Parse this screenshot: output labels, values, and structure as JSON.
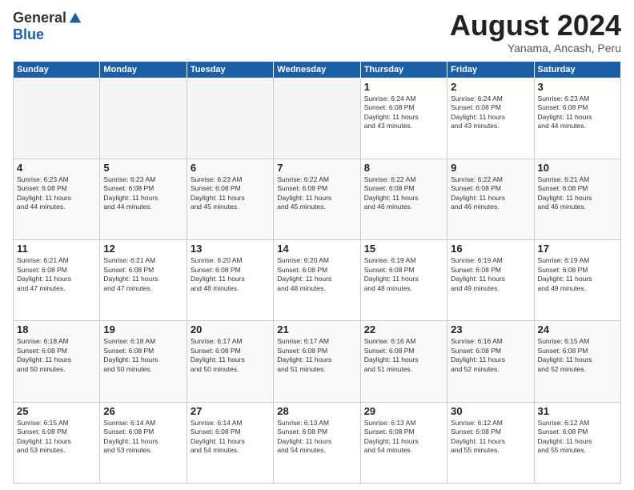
{
  "header": {
    "logo": {
      "general": "General",
      "blue": "Blue"
    },
    "title": "August 2024",
    "subtitle": "Yanama, Ancash, Peru"
  },
  "days_of_week": [
    "Sunday",
    "Monday",
    "Tuesday",
    "Wednesday",
    "Thursday",
    "Friday",
    "Saturday"
  ],
  "weeks": [
    [
      {
        "num": "",
        "info": ""
      },
      {
        "num": "",
        "info": ""
      },
      {
        "num": "",
        "info": ""
      },
      {
        "num": "",
        "info": ""
      },
      {
        "num": "1",
        "info": "Sunrise: 6:24 AM\nSunset: 6:08 PM\nDaylight: 11 hours\nand 43 minutes."
      },
      {
        "num": "2",
        "info": "Sunrise: 6:24 AM\nSunset: 6:08 PM\nDaylight: 11 hours\nand 43 minutes."
      },
      {
        "num": "3",
        "info": "Sunrise: 6:23 AM\nSunset: 6:08 PM\nDaylight: 11 hours\nand 44 minutes."
      }
    ],
    [
      {
        "num": "4",
        "info": "Sunrise: 6:23 AM\nSunset: 6:08 PM\nDaylight: 11 hours\nand 44 minutes."
      },
      {
        "num": "5",
        "info": "Sunrise: 6:23 AM\nSunset: 6:08 PM\nDaylight: 11 hours\nand 44 minutes."
      },
      {
        "num": "6",
        "info": "Sunrise: 6:23 AM\nSunset: 6:08 PM\nDaylight: 11 hours\nand 45 minutes."
      },
      {
        "num": "7",
        "info": "Sunrise: 6:22 AM\nSunset: 6:08 PM\nDaylight: 11 hours\nand 45 minutes."
      },
      {
        "num": "8",
        "info": "Sunrise: 6:22 AM\nSunset: 6:08 PM\nDaylight: 11 hours\nand 46 minutes."
      },
      {
        "num": "9",
        "info": "Sunrise: 6:22 AM\nSunset: 6:08 PM\nDaylight: 11 hours\nand 46 minutes."
      },
      {
        "num": "10",
        "info": "Sunrise: 6:21 AM\nSunset: 6:08 PM\nDaylight: 11 hours\nand 46 minutes."
      }
    ],
    [
      {
        "num": "11",
        "info": "Sunrise: 6:21 AM\nSunset: 6:08 PM\nDaylight: 11 hours\nand 47 minutes."
      },
      {
        "num": "12",
        "info": "Sunrise: 6:21 AM\nSunset: 6:08 PM\nDaylight: 11 hours\nand 47 minutes."
      },
      {
        "num": "13",
        "info": "Sunrise: 6:20 AM\nSunset: 6:08 PM\nDaylight: 11 hours\nand 48 minutes."
      },
      {
        "num": "14",
        "info": "Sunrise: 6:20 AM\nSunset: 6:08 PM\nDaylight: 11 hours\nand 48 minutes."
      },
      {
        "num": "15",
        "info": "Sunrise: 6:19 AM\nSunset: 6:08 PM\nDaylight: 11 hours\nand 48 minutes."
      },
      {
        "num": "16",
        "info": "Sunrise: 6:19 AM\nSunset: 6:08 PM\nDaylight: 11 hours\nand 49 minutes."
      },
      {
        "num": "17",
        "info": "Sunrise: 6:19 AM\nSunset: 6:08 PM\nDaylight: 11 hours\nand 49 minutes."
      }
    ],
    [
      {
        "num": "18",
        "info": "Sunrise: 6:18 AM\nSunset: 6:08 PM\nDaylight: 11 hours\nand 50 minutes."
      },
      {
        "num": "19",
        "info": "Sunrise: 6:18 AM\nSunset: 6:08 PM\nDaylight: 11 hours\nand 50 minutes."
      },
      {
        "num": "20",
        "info": "Sunrise: 6:17 AM\nSunset: 6:08 PM\nDaylight: 11 hours\nand 50 minutes."
      },
      {
        "num": "21",
        "info": "Sunrise: 6:17 AM\nSunset: 6:08 PM\nDaylight: 11 hours\nand 51 minutes."
      },
      {
        "num": "22",
        "info": "Sunrise: 6:16 AM\nSunset: 6:08 PM\nDaylight: 11 hours\nand 51 minutes."
      },
      {
        "num": "23",
        "info": "Sunrise: 6:16 AM\nSunset: 6:08 PM\nDaylight: 11 hours\nand 52 minutes."
      },
      {
        "num": "24",
        "info": "Sunrise: 6:15 AM\nSunset: 6:08 PM\nDaylight: 11 hours\nand 52 minutes."
      }
    ],
    [
      {
        "num": "25",
        "info": "Sunrise: 6:15 AM\nSunset: 6:08 PM\nDaylight: 11 hours\nand 53 minutes."
      },
      {
        "num": "26",
        "info": "Sunrise: 6:14 AM\nSunset: 6:08 PM\nDaylight: 11 hours\nand 53 minutes."
      },
      {
        "num": "27",
        "info": "Sunrise: 6:14 AM\nSunset: 6:08 PM\nDaylight: 11 hours\nand 54 minutes."
      },
      {
        "num": "28",
        "info": "Sunrise: 6:13 AM\nSunset: 6:08 PM\nDaylight: 11 hours\nand 54 minutes."
      },
      {
        "num": "29",
        "info": "Sunrise: 6:13 AM\nSunset: 6:08 PM\nDaylight: 11 hours\nand 54 minutes."
      },
      {
        "num": "30",
        "info": "Sunrise: 6:12 AM\nSunset: 6:08 PM\nDaylight: 11 hours\nand 55 minutes."
      },
      {
        "num": "31",
        "info": "Sunrise: 6:12 AM\nSunset: 6:08 PM\nDaylight: 11 hours\nand 55 minutes."
      }
    ]
  ]
}
